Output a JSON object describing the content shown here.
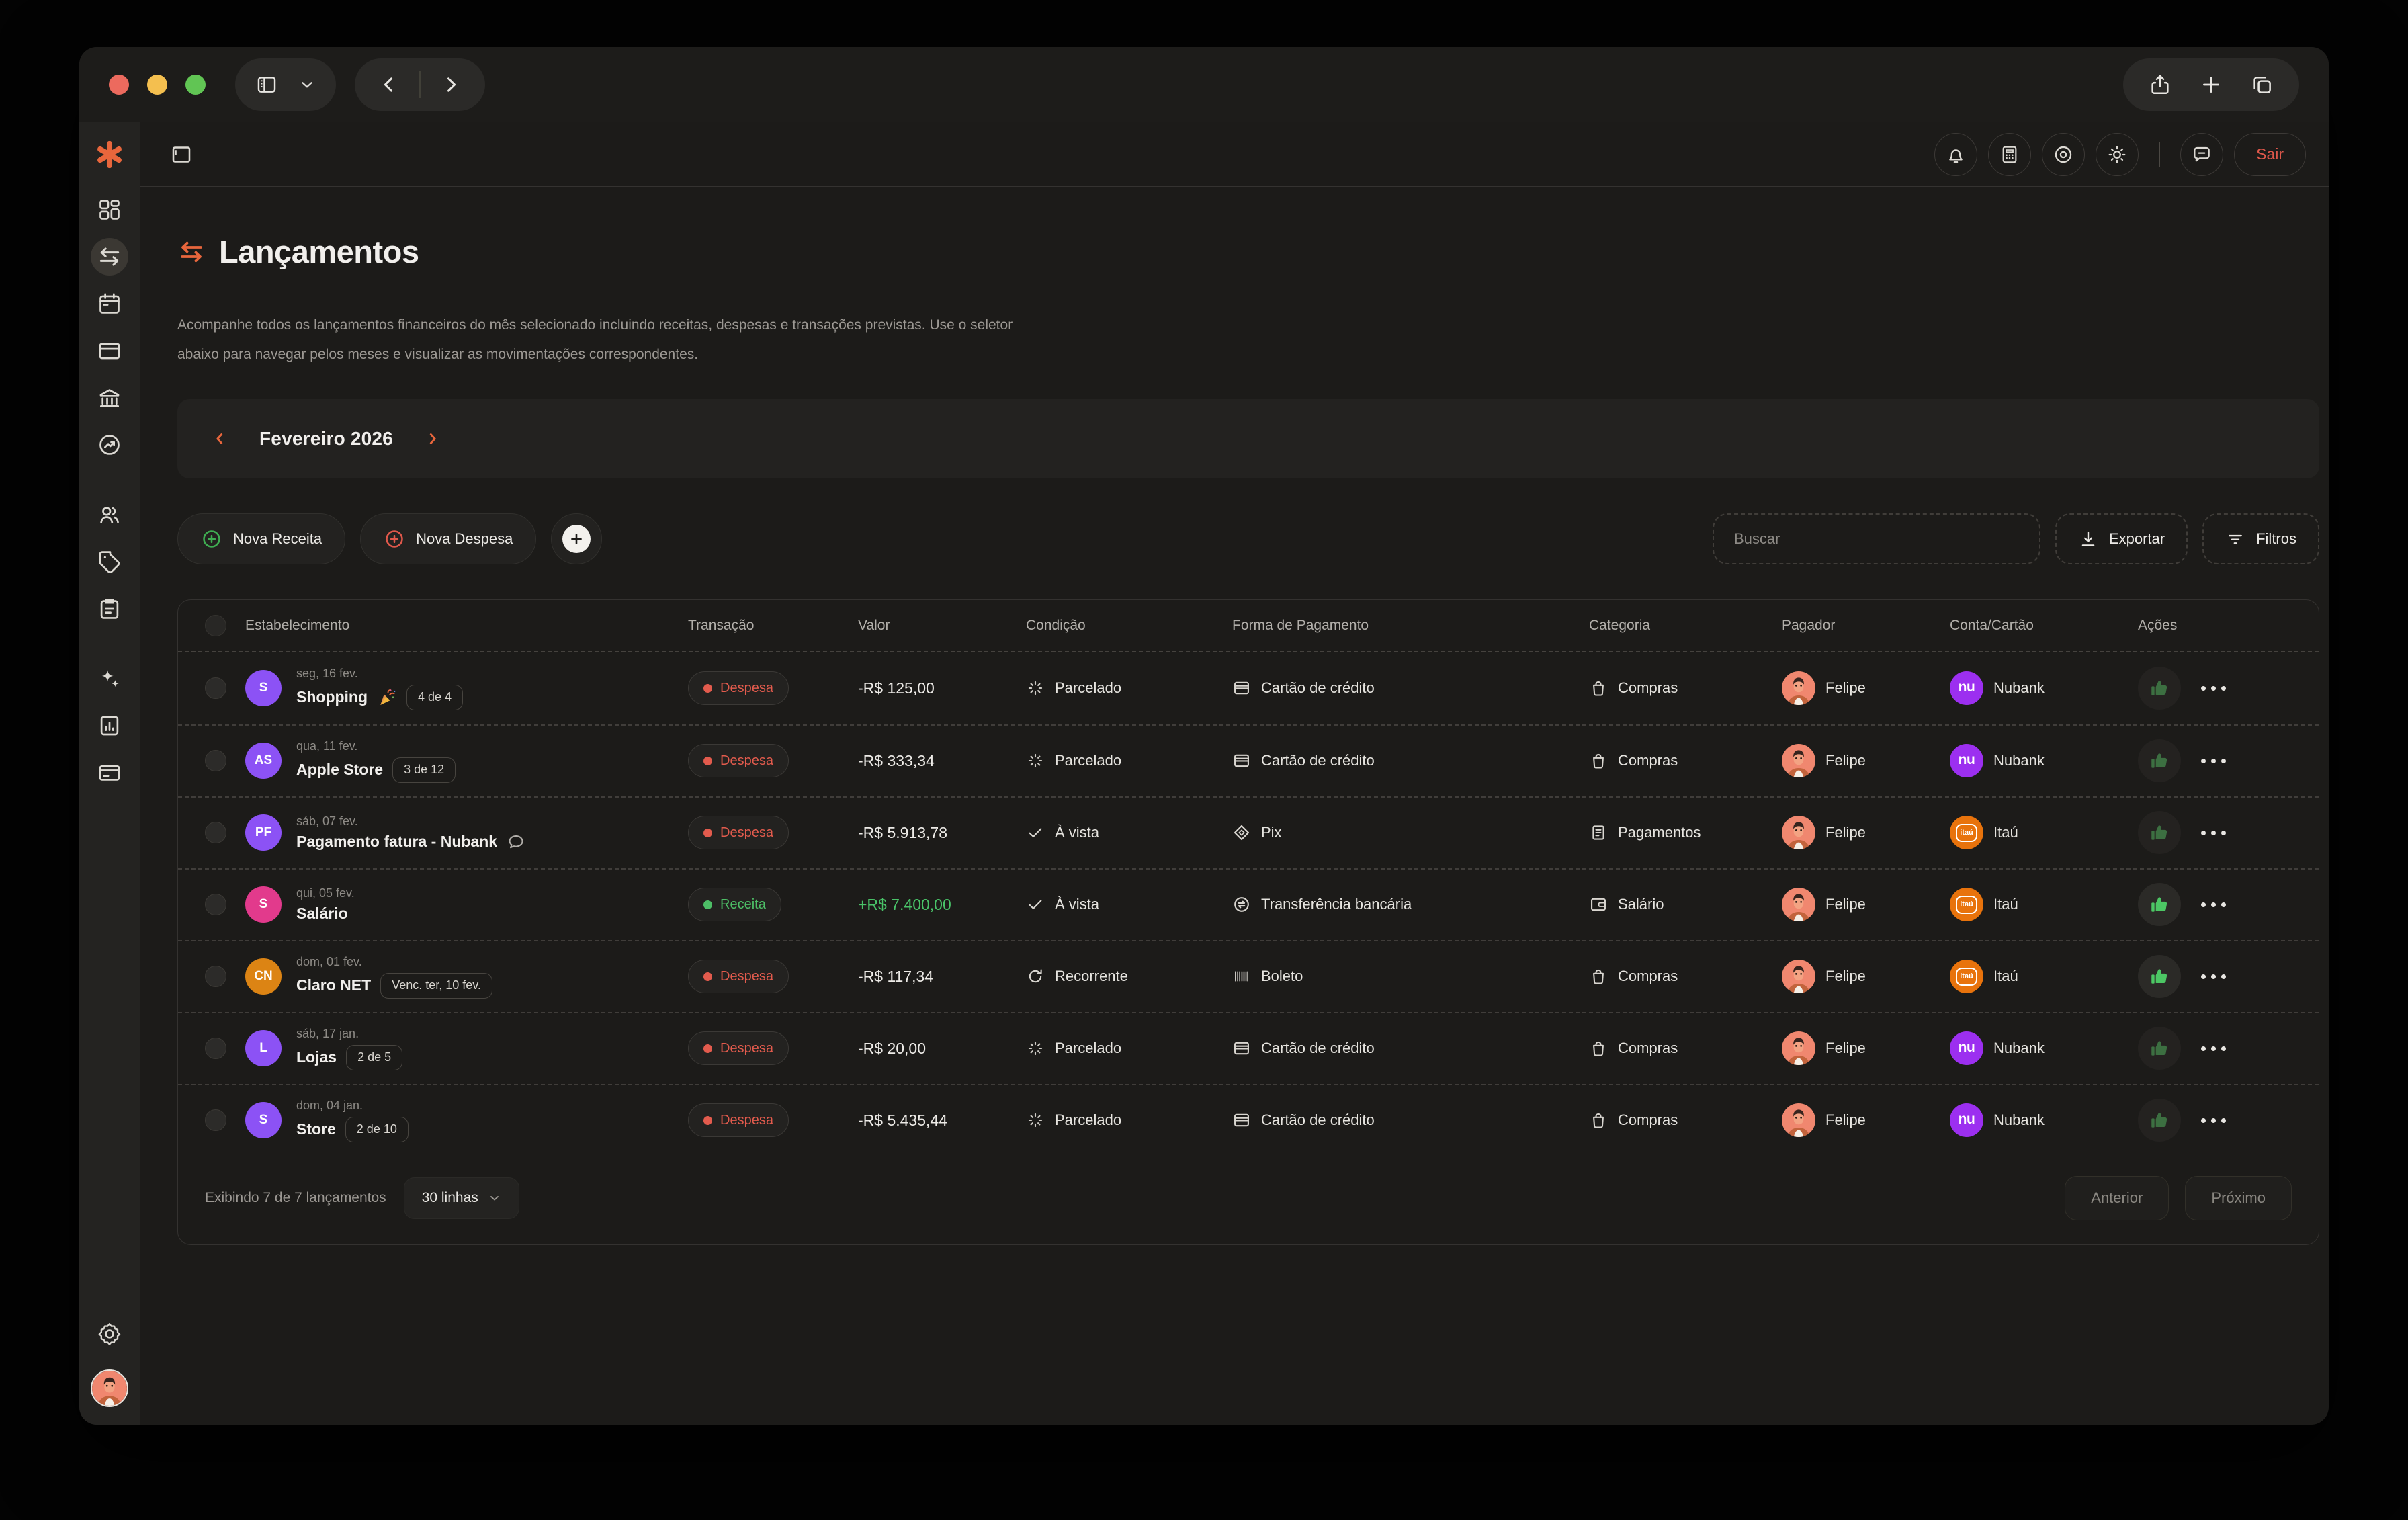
{
  "header": {
    "logout_label": "Sair"
  },
  "page": {
    "title": "Lançamentos",
    "description": "Acompanhe todos os lançamentos financeiros do mês selecionado incluindo receitas, despesas e transações previstas. Use o seletor abaixo para navegar pelos meses e visualizar as movimentações correspondentes."
  },
  "month_selector": {
    "label": "Fevereiro 2026"
  },
  "toolbar": {
    "new_income_label": "Nova Receita",
    "new_expense_label": "Nova Despesa",
    "search_placeholder": "Buscar",
    "export_label": "Exportar",
    "filters_label": "Filtros"
  },
  "colors": {
    "accent_orange": "#E8663C",
    "expense_red": "#E25B4D",
    "income_green": "#4DBE66",
    "nubank_purple": "#9C2FF0",
    "itau_orange": "#E8730C"
  },
  "table": {
    "columns": [
      "Estabelecimento",
      "Transação",
      "Valor",
      "Condição",
      "Forma de Pagamento",
      "Categoria",
      "Pagador",
      "Conta/Cartão",
      "Ações"
    ],
    "rows": [
      {
        "initials": "S",
        "avatar_color": "#8C52F5",
        "date": "seg, 16 fev.",
        "name": "Shopping",
        "emoji_icon": "party-popper",
        "badge": "4 de 4",
        "has_comment": false,
        "type_label": "Despesa",
        "type_kind": "expense",
        "value": "-R$ 125,00",
        "value_positive": false,
        "condition_label": "Parcelado",
        "condition_icon": "installments",
        "payment_label": "Cartão de crédito",
        "payment_icon": "credit-card",
        "category_label": "Compras",
        "category_icon": "shopping-bag",
        "payer": "Felipe",
        "account_label": "Nubank",
        "account_logo": "nubank",
        "liked": false
      },
      {
        "initials": "AS",
        "avatar_color": "#8C52F5",
        "date": "qua, 11 fev.",
        "name": "Apple Store",
        "emoji_icon": null,
        "badge": "3 de 12",
        "has_comment": false,
        "type_label": "Despesa",
        "type_kind": "expense",
        "value": "-R$ 333,34",
        "value_positive": false,
        "condition_label": "Parcelado",
        "condition_icon": "installments",
        "payment_label": "Cartão de crédito",
        "payment_icon": "credit-card",
        "category_label": "Compras",
        "category_icon": "shopping-bag",
        "payer": "Felipe",
        "account_label": "Nubank",
        "account_logo": "nubank",
        "liked": false
      },
      {
        "initials": "PF",
        "avatar_color": "#8C52F5",
        "date": "sáb, 07 fev.",
        "name": "Pagamento fatura - Nubank",
        "emoji_icon": null,
        "badge": null,
        "has_comment": true,
        "type_label": "Despesa",
        "type_kind": "expense",
        "value": "-R$ 5.913,78",
        "value_positive": false,
        "condition_label": "À vista",
        "condition_icon": "cash",
        "payment_label": "Pix",
        "payment_icon": "pix",
        "category_label": "Pagamentos",
        "category_icon": "receipt",
        "payer": "Felipe",
        "account_label": "Itaú",
        "account_logo": "itau",
        "liked": false
      },
      {
        "initials": "S",
        "avatar_color": "#E23A8C",
        "date": "qui, 05 fev.",
        "name": "Salário",
        "emoji_icon": null,
        "badge": null,
        "has_comment": false,
        "type_label": "Receita",
        "type_kind": "income",
        "value": "+R$ 7.400,00",
        "value_positive": true,
        "condition_label": "À vista",
        "condition_icon": "cash",
        "payment_label": "Transferência bancária",
        "payment_icon": "bank-transfer",
        "category_label": "Salário",
        "category_icon": "wallet",
        "payer": "Felipe",
        "account_label": "Itaú",
        "account_logo": "itau",
        "liked": true
      },
      {
        "initials": "CN",
        "avatar_color": "#DC8414",
        "date": "dom, 01 fev.",
        "name": "Claro NET",
        "emoji_icon": null,
        "badge": "Venc. ter, 10 fev.",
        "has_comment": false,
        "type_label": "Despesa",
        "type_kind": "expense",
        "value": "-R$ 117,34",
        "value_positive": false,
        "condition_label": "Recorrente",
        "condition_icon": "recurring",
        "payment_label": "Boleto",
        "payment_icon": "barcode",
        "category_label": "Compras",
        "category_icon": "shopping-bag",
        "payer": "Felipe",
        "account_label": "Itaú",
        "account_logo": "itau",
        "liked": true
      },
      {
        "initials": "L",
        "avatar_color": "#8C52F5",
        "date": "sáb, 17 jan.",
        "name": "Lojas",
        "emoji_icon": null,
        "badge": "2 de 5",
        "has_comment": false,
        "type_label": "Despesa",
        "type_kind": "expense",
        "value": "-R$ 20,00",
        "value_positive": false,
        "condition_label": "Parcelado",
        "condition_icon": "installments",
        "payment_label": "Cartão de crédito",
        "payment_icon": "credit-card",
        "category_label": "Compras",
        "category_icon": "shopping-bag",
        "payer": "Felipe",
        "account_label": "Nubank",
        "account_logo": "nubank",
        "liked": false
      },
      {
        "initials": "S",
        "avatar_color": "#8C52F5",
        "date": "dom, 04 jan.",
        "name": "Store",
        "emoji_icon": null,
        "badge": "2 de 10",
        "has_comment": false,
        "type_label": "Despesa",
        "type_kind": "expense",
        "value": "-R$ 5.435,44",
        "value_positive": false,
        "condition_label": "Parcelado",
        "condition_icon": "installments",
        "payment_label": "Cartão de crédito",
        "payment_icon": "credit-card",
        "category_label": "Compras",
        "category_icon": "shopping-bag",
        "payer": "Felipe",
        "account_label": "Nubank",
        "account_logo": "nubank",
        "liked": false
      }
    ]
  },
  "footer": {
    "summary": "Exibindo 7 de 7 lançamentos",
    "rows_per_page": "30 linhas",
    "prev_label": "Anterior",
    "next_label": "Próximo"
  }
}
